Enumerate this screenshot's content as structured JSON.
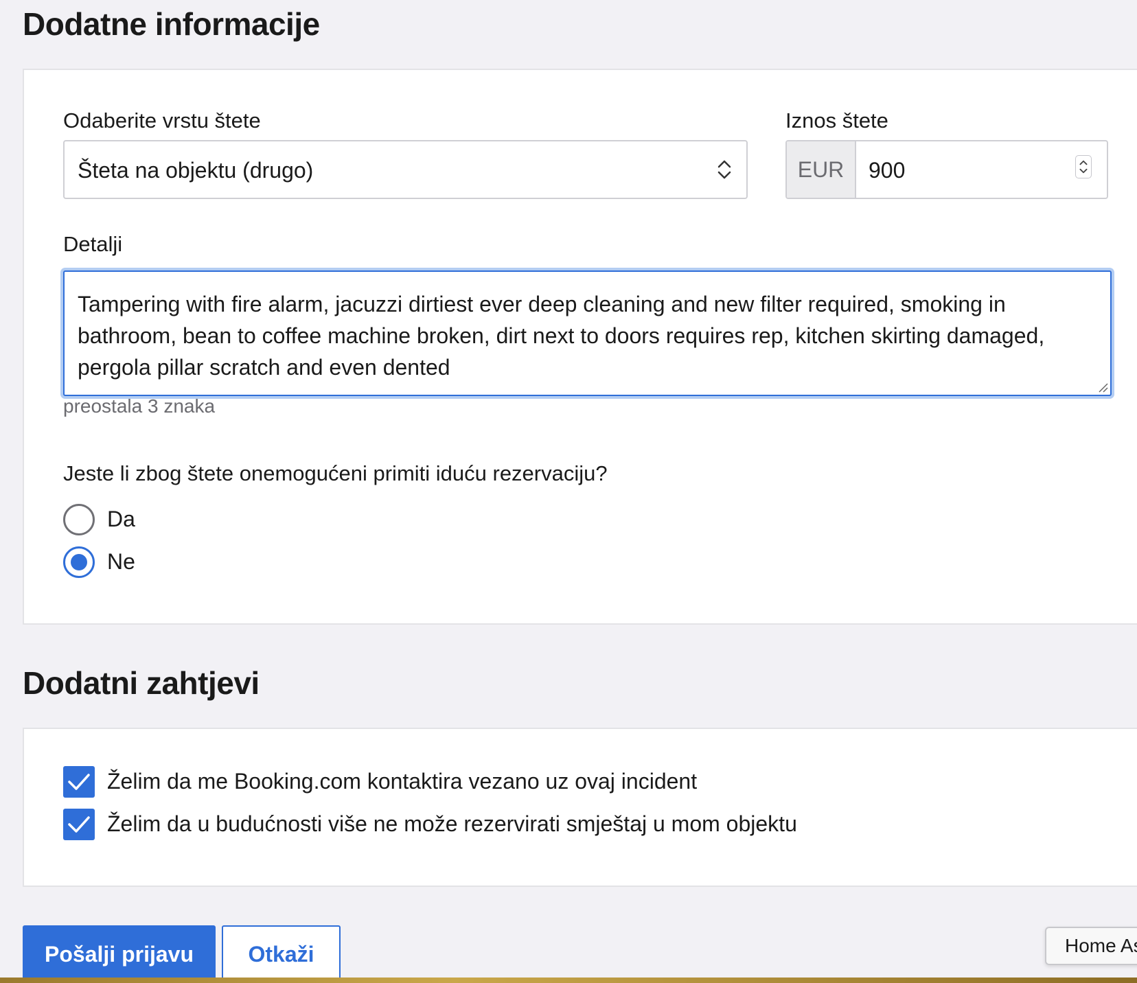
{
  "section1": {
    "title": "Dodatne informacije",
    "damage_type": {
      "label": "Odaberite vrstu štete",
      "selected": "Šteta na objektu (drugo)"
    },
    "amount": {
      "label": "Iznos štete",
      "currency": "EUR",
      "value": "900"
    },
    "details": {
      "label": "Detalji",
      "text": "Tampering with fire alarm, jacuzzi dirtiest ever deep cleaning and new filter required, smoking in bathroom, bean to coffee machine broken, dirt next to doors requires rep, kitchen skirting damaged, pergola pillar scratch and even dented",
      "remaining": "preostala 3 znaka"
    },
    "question": {
      "text": "Jeste li zbog štete onemogućeni primiti iduću rezervaciju?",
      "options": [
        {
          "label": "Da",
          "selected": false
        },
        {
          "label": "Ne",
          "selected": true
        }
      ]
    }
  },
  "section2": {
    "title": "Dodatni zahtjevi",
    "checkboxes": [
      {
        "label": "Želim da me Booking.com kontaktira vezano uz ovaj incident",
        "checked": true
      },
      {
        "label": "Želim da u budućnosti više ne može rezervirati smještaj u mom objektu",
        "checked": true
      }
    ]
  },
  "actions": {
    "submit": "Pošalji prijavu",
    "cancel": "Otkaži"
  },
  "tooltip": "Home As",
  "colors": {
    "accent": "#2f6ed8",
    "background": "#f2f1f5",
    "card": "#ffffff"
  }
}
